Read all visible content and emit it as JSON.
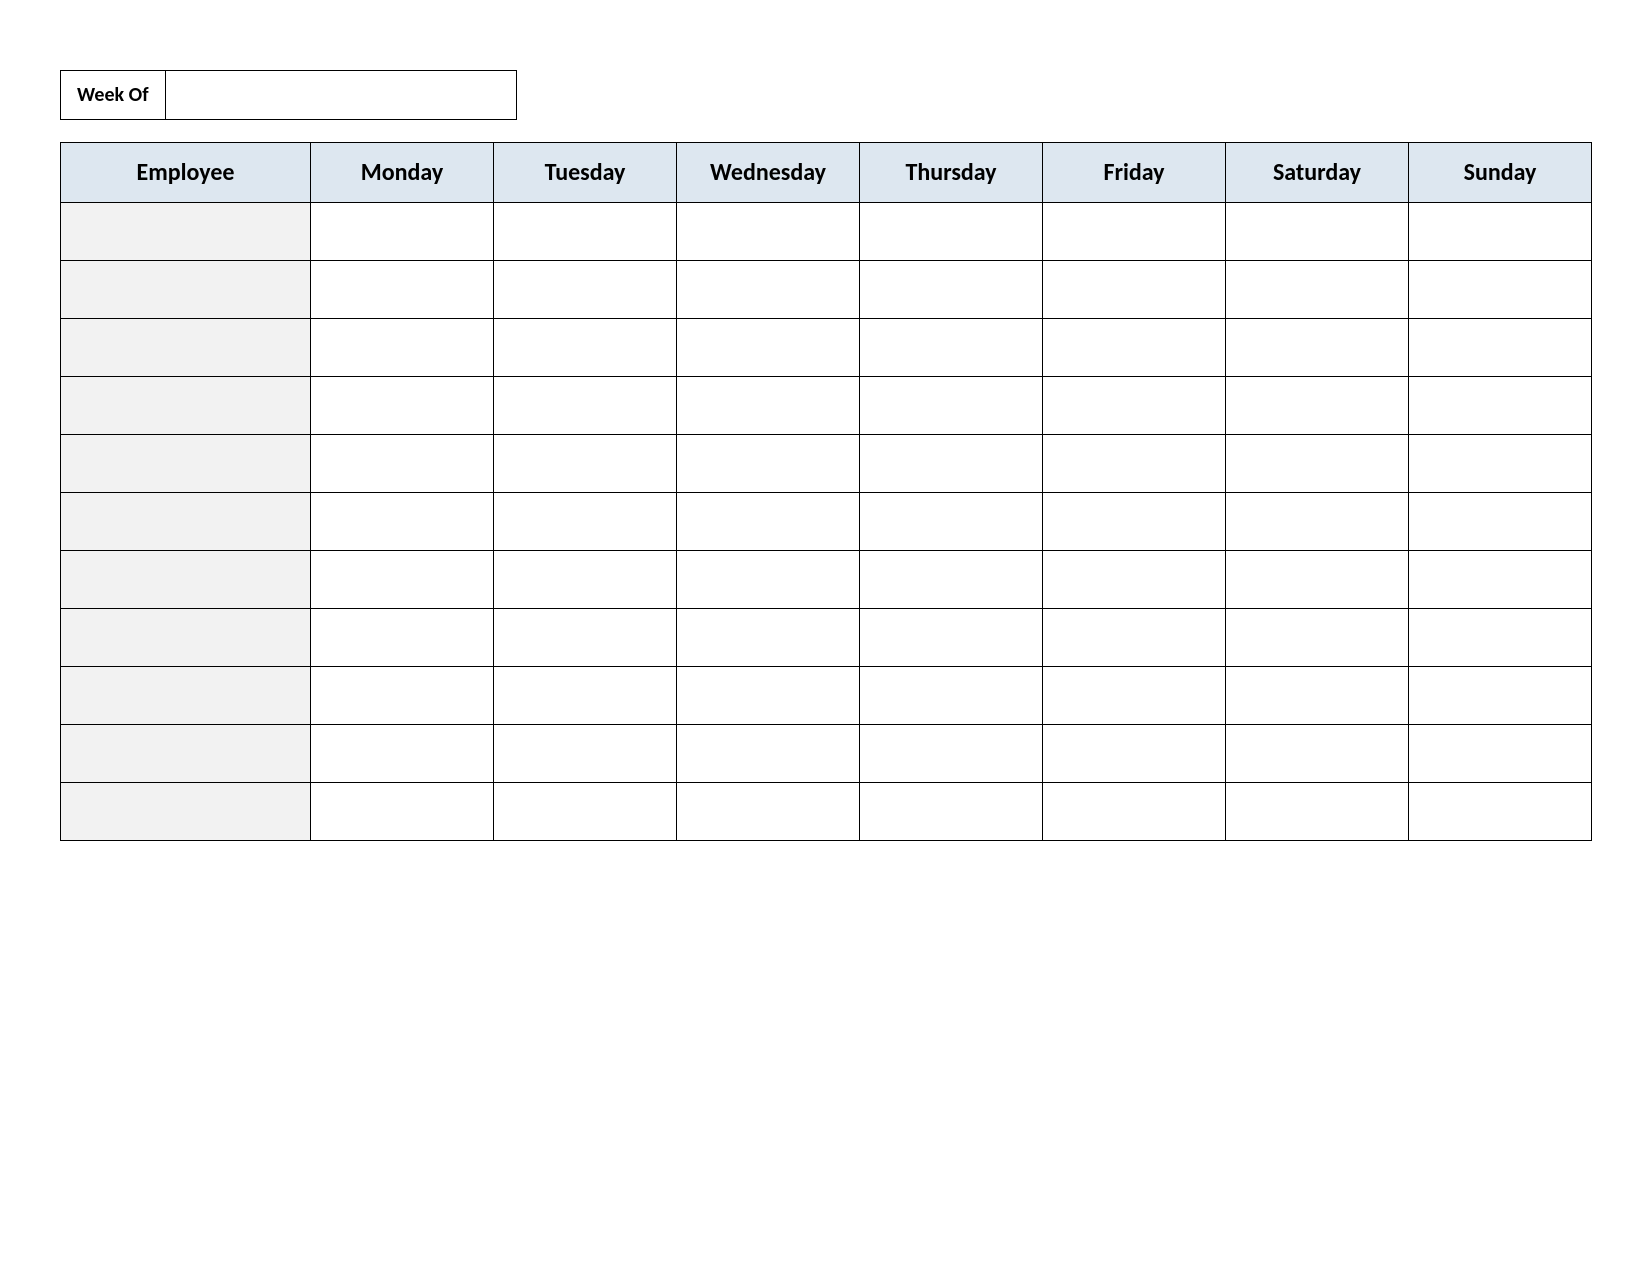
{
  "week_of": {
    "label": "Week Of",
    "value": ""
  },
  "headers": {
    "employee": "Employee",
    "days": [
      "Monday",
      "Tuesday",
      "Wednesday",
      "Thursday",
      "Friday",
      "Saturday",
      "Sunday"
    ]
  },
  "rows": [
    {
      "employee": "",
      "cells": [
        "",
        "",
        "",
        "",
        "",
        "",
        ""
      ]
    },
    {
      "employee": "",
      "cells": [
        "",
        "",
        "",
        "",
        "",
        "",
        ""
      ]
    },
    {
      "employee": "",
      "cells": [
        "",
        "",
        "",
        "",
        "",
        "",
        ""
      ]
    },
    {
      "employee": "",
      "cells": [
        "",
        "",
        "",
        "",
        "",
        "",
        ""
      ]
    },
    {
      "employee": "",
      "cells": [
        "",
        "",
        "",
        "",
        "",
        "",
        ""
      ]
    },
    {
      "employee": "",
      "cells": [
        "",
        "",
        "",
        "",
        "",
        "",
        ""
      ]
    },
    {
      "employee": "",
      "cells": [
        "",
        "",
        "",
        "",
        "",
        "",
        ""
      ]
    },
    {
      "employee": "",
      "cells": [
        "",
        "",
        "",
        "",
        "",
        "",
        ""
      ]
    },
    {
      "employee": "",
      "cells": [
        "",
        "",
        "",
        "",
        "",
        "",
        ""
      ]
    },
    {
      "employee": "",
      "cells": [
        "",
        "",
        "",
        "",
        "",
        "",
        ""
      ]
    },
    {
      "employee": "",
      "cells": [
        "",
        "",
        "",
        "",
        "",
        "",
        ""
      ]
    }
  ]
}
